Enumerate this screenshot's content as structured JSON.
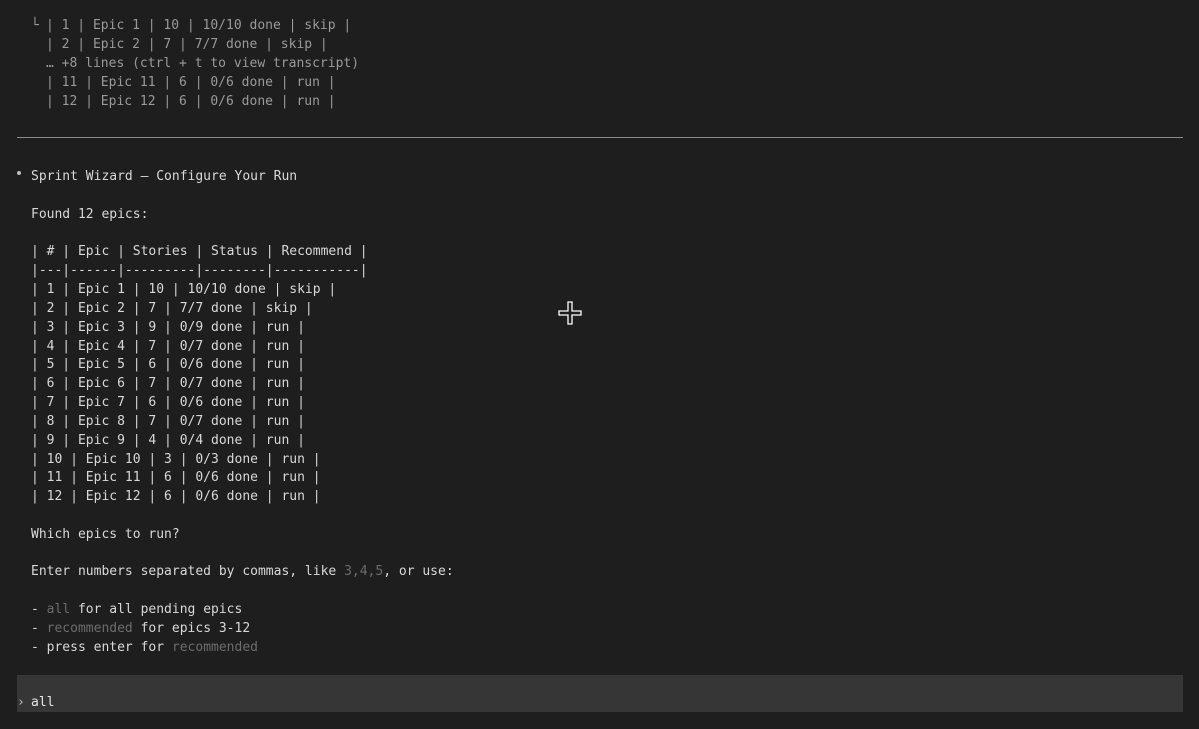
{
  "previous_output": {
    "tree_glyph": "└",
    "lines": [
      "| 1 | Epic 1 | 10 | 10/10 done | skip |",
      "| 2 | Epic 2 | 7 | 7/7 done | skip |",
      "… +8 lines (ctrl + t to view transcript)",
      "| 11 | Epic 11 | 6 | 0/6 done | run |",
      "| 12 | Epic 12 | 6 | 0/6 done | run |"
    ]
  },
  "message": {
    "title": "Sprint Wizard — Configure Your Run",
    "found_text": "Found 12 epics:",
    "table": {
      "header": "| # | Epic | Stories | Status | Recommend |",
      "separator": "|---|------|---------|--------|-----------|",
      "rows": [
        "| 1 | Epic 1 | 10 | 10/10 done | skip |",
        "| 2 | Epic 2 | 7 | 7/7 done | skip |",
        "| 3 | Epic 3 | 9 | 0/9 done | run |",
        "| 4 | Epic 4 | 7 | 0/7 done | run |",
        "| 5 | Epic 5 | 6 | 0/6 done | run |",
        "| 6 | Epic 6 | 7 | 0/7 done | run |",
        "| 7 | Epic 7 | 6 | 0/6 done | run |",
        "| 8 | Epic 8 | 7 | 0/7 done | run |",
        "| 9 | Epic 9 | 4 | 0/4 done | run |",
        "| 10 | Epic 10 | 3 | 0/3 done | run |",
        "| 11 | Epic 11 | 6 | 0/6 done | run |",
        "| 12 | Epic 12 | 6 | 0/6 done | run |"
      ]
    },
    "question": "Which epics to run?",
    "instruction": {
      "prefix": "Enter numbers separated by commas, like ",
      "example": "3,4,5",
      "suffix": ", or use:"
    },
    "options": [
      {
        "dash": "- ",
        "keyword": "all",
        "text": " for all pending epics"
      },
      {
        "dash": "- ",
        "keyword": "recommended",
        "text": " for epics 3-12"
      },
      {
        "dash": "- ",
        "prefix": "press enter for ",
        "keyword": "recommended"
      }
    ]
  },
  "input": {
    "prompt": "›",
    "value": "all"
  },
  "icons": {
    "cursor": "crosshair-cursor-icon"
  },
  "colors": {
    "background": "#1e1e1e",
    "input_bar": "#363636",
    "divider": "#8a8a8a",
    "muted_keyword": "#6c6c6c"
  }
}
